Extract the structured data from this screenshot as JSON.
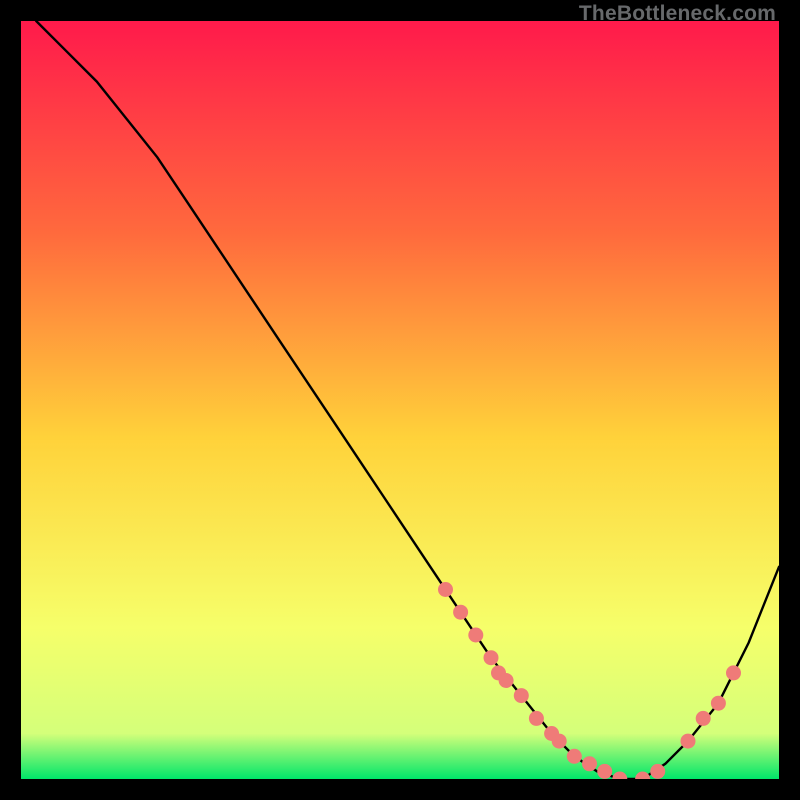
{
  "attribution": "TheBottleneck.com",
  "colors": {
    "gradient_top": "#ff1a4b",
    "gradient_mid1": "#ff7a3a",
    "gradient_mid2": "#ffd23a",
    "gradient_mid3": "#f8ff6a",
    "gradient_bottom": "#00e66a",
    "curve": "#000000",
    "marker": "#ef7b78",
    "frame": "#000000"
  },
  "chart_data": {
    "type": "line",
    "title": "",
    "xlabel": "",
    "ylabel": "",
    "xlim": [
      0,
      100
    ],
    "ylim": [
      0,
      100
    ],
    "series": [
      {
        "name": "bottleneck-curve",
        "x": [
          2,
          6,
          10,
          14,
          18,
          22,
          26,
          30,
          34,
          38,
          42,
          46,
          50,
          54,
          58,
          62,
          66,
          70,
          73,
          76,
          79,
          82,
          85,
          88,
          92,
          96,
          100
        ],
        "y": [
          100,
          96,
          92,
          87,
          82,
          76,
          70,
          64,
          58,
          52,
          46,
          40,
          34,
          28,
          22,
          16,
          11,
          6,
          3,
          1,
          0,
          0,
          2,
          5,
          10,
          18,
          28
        ]
      }
    ],
    "markers": {
      "name": "highlight-dots",
      "points": [
        {
          "x": 56,
          "y": 25
        },
        {
          "x": 58,
          "y": 22
        },
        {
          "x": 60,
          "y": 19
        },
        {
          "x": 62,
          "y": 16
        },
        {
          "x": 63,
          "y": 14
        },
        {
          "x": 64,
          "y": 13
        },
        {
          "x": 66,
          "y": 11
        },
        {
          "x": 68,
          "y": 8
        },
        {
          "x": 70,
          "y": 6
        },
        {
          "x": 71,
          "y": 5
        },
        {
          "x": 73,
          "y": 3
        },
        {
          "x": 75,
          "y": 2
        },
        {
          "x": 77,
          "y": 1
        },
        {
          "x": 79,
          "y": 0
        },
        {
          "x": 82,
          "y": 0
        },
        {
          "x": 84,
          "y": 1
        },
        {
          "x": 88,
          "y": 5
        },
        {
          "x": 90,
          "y": 8
        },
        {
          "x": 92,
          "y": 10
        },
        {
          "x": 94,
          "y": 14
        }
      ]
    }
  }
}
